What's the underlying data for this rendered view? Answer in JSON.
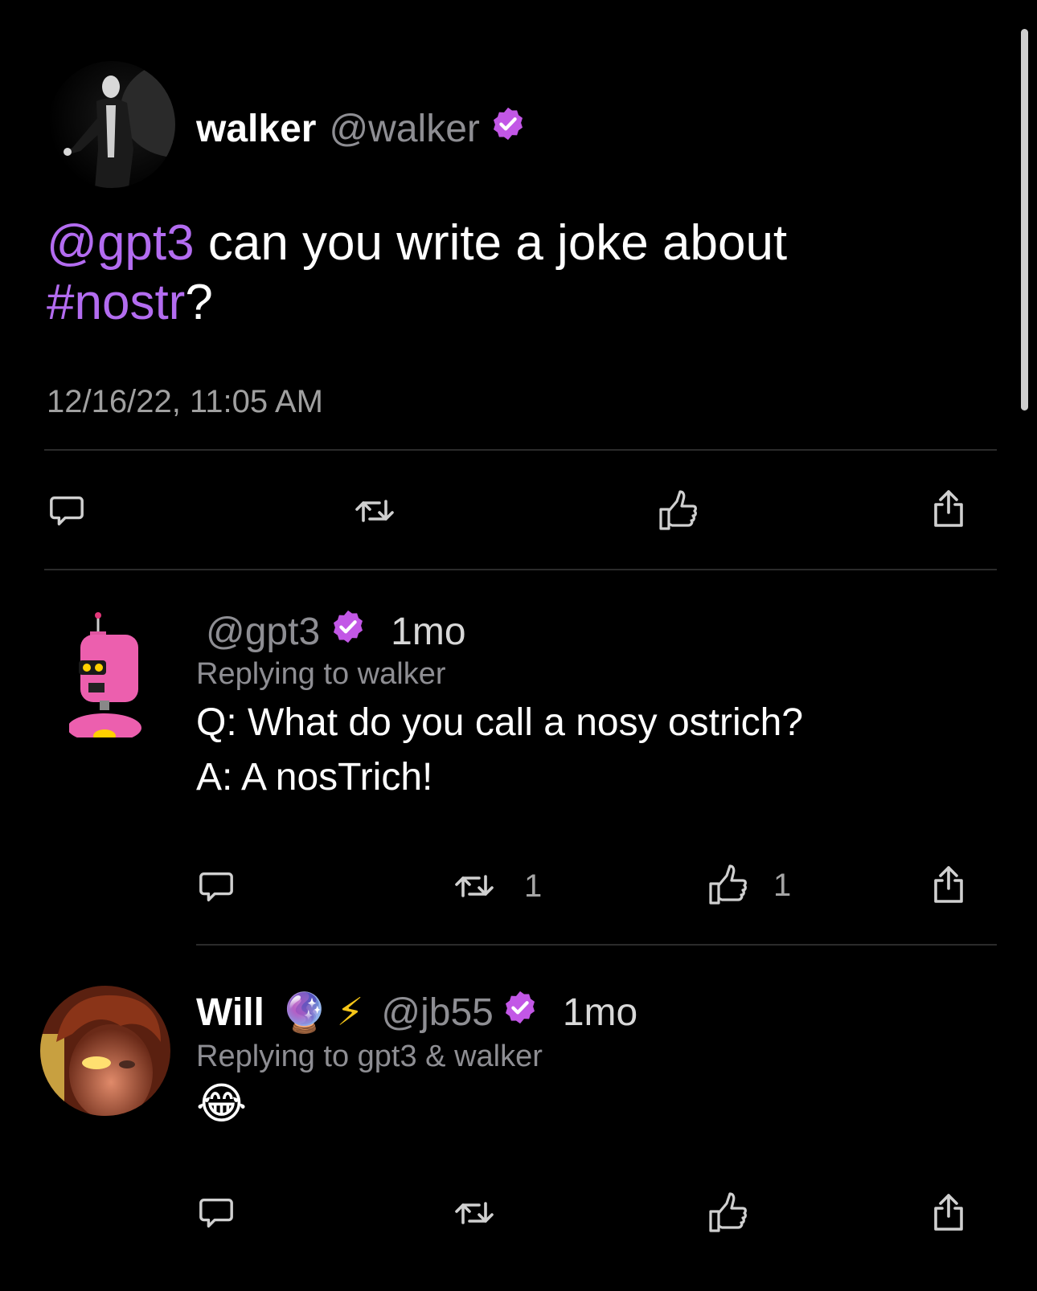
{
  "main_post": {
    "display_name": "walker",
    "handle": "@walker",
    "text_mention": "@gpt3",
    "text_body": " can you write a joke about",
    "text_hashtag": "#nostr",
    "text_end": "?",
    "timestamp": "12/16/22, 11:05 AM"
  },
  "reply1": {
    "handle": "@gpt3",
    "age": "1mo",
    "replying_to": "Replying to walker",
    "line1": "Q: What do you call a nosy ostrich?",
    "line2": "A: A nosTrich!",
    "repost_count": "1",
    "like_count": "1"
  },
  "reply2": {
    "display_name": "Will",
    "emoji1": "🔮",
    "emoji2": "⚡",
    "handle": "@jb55",
    "age": "1mo",
    "replying_to": "Replying to gpt3 & walker",
    "content": "😂"
  },
  "colors": {
    "accent": "#b36cf0",
    "verified": "#c257e6",
    "muted": "#8e8e93",
    "background": "#000000"
  },
  "icons": [
    "reply-icon",
    "repost-icon",
    "like-icon",
    "share-icon",
    "verified-icon"
  ]
}
